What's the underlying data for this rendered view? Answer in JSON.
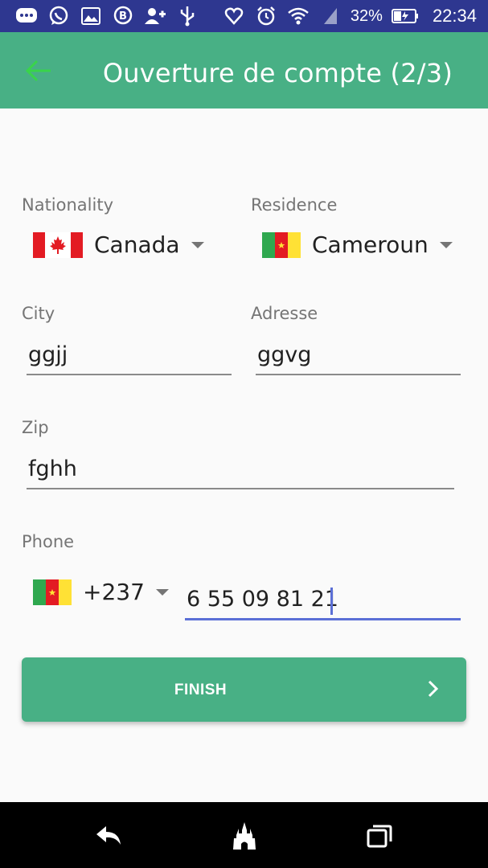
{
  "status_bar": {
    "battery_percent": "32%",
    "time": "22:34"
  },
  "app_bar": {
    "title": "Ouverture de compte (2/3)"
  },
  "form": {
    "nationality": {
      "label": "Nationality",
      "value": "Canada",
      "flag": "canada-flag"
    },
    "residence": {
      "label": "Residence",
      "value": "Cameroun",
      "flag": "cameroon-flag"
    },
    "city": {
      "label": "City",
      "value": "ggjj"
    },
    "address": {
      "label": "Adresse",
      "value": "ggvg"
    },
    "zip": {
      "label": "Zip",
      "value": "fghh"
    },
    "phone": {
      "label": "Phone",
      "country_code": "+237",
      "flag": "cameroon-flag",
      "number": "6 55 09 81 21"
    }
  },
  "finish_button": {
    "label": "FINISH"
  },
  "colors": {
    "status_bar": "#2e3790",
    "app_bar": "#48b085",
    "accent": "#5b6fd6",
    "back_arrow": "#39d44a"
  }
}
